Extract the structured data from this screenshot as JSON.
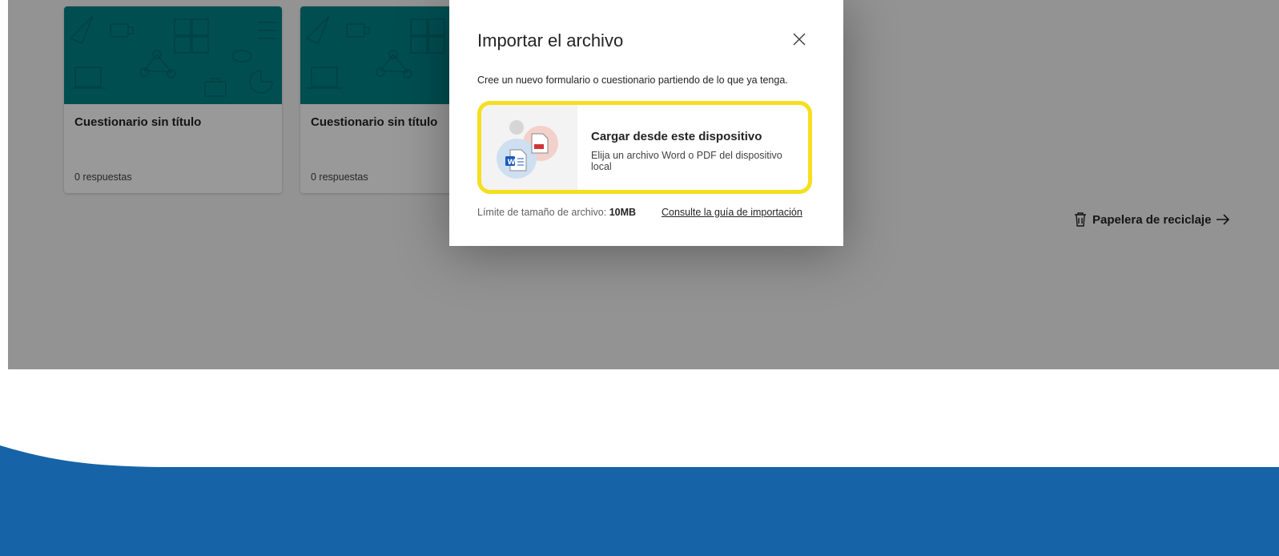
{
  "cards": [
    {
      "title": "Cuestionario sin título",
      "responses": "0 respuestas"
    },
    {
      "title": "Cuestionario sin título",
      "responses": "0 respuestas"
    }
  ],
  "recycle_bin": {
    "label": "Papelera de reciclaje",
    "icon": "trash-icon",
    "arrow_icon": "arrow-right-icon"
  },
  "dialog": {
    "title": "Importar el archivo",
    "description": "Cree un nuevo formulario o cuestionario partiendo de lo que ya tenga.",
    "option": {
      "title": "Cargar desde este dispositivo",
      "subtitle": "Elija un archivo Word o PDF del dispositivo local",
      "highlight_color": "#f5df1e"
    },
    "limit_label": "Límite de tamaño de archivo:",
    "limit_value": "10MB",
    "guide_link": "Consulte la guía de importación"
  },
  "colors": {
    "card_thumbnail": "#038387",
    "footer_wave": "#1664a7",
    "word_blue": "#185abd",
    "pdf_red": "#d13438"
  }
}
